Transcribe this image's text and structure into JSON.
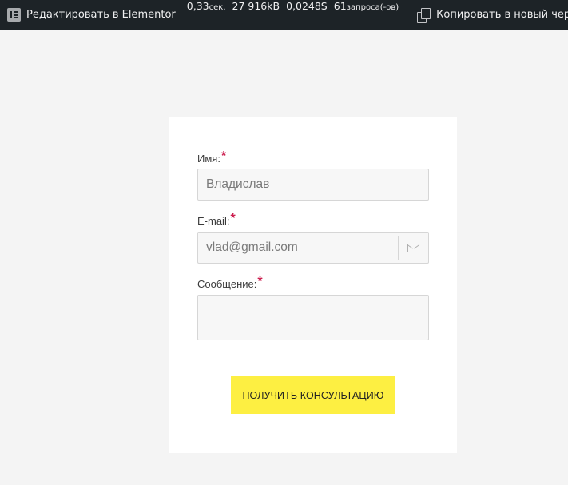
{
  "adminbar": {
    "elementor_label": "Редактировать в Elementor",
    "query_monitor": {
      "time_value": "0,33",
      "time_unit": "сек.",
      "memory": "27 916kB",
      "db_time": "0,0248S",
      "queries_count": "61",
      "queries_unit": "запроса(-ов)"
    },
    "copy_draft_label": "Копировать в новый черновик"
  },
  "form": {
    "name": {
      "label": "Имя:",
      "required_mark": "*",
      "value": "Владислав"
    },
    "email": {
      "label": "E-mail:",
      "required_mark": "*",
      "value": "vlad@gmail.com"
    },
    "message": {
      "label": "Сообщение:",
      "required_mark": "*",
      "value": ""
    },
    "submit_label": "ПОЛУЧИТЬ КОНСУЛЬТАЦИЮ"
  },
  "colors": {
    "adminbar_bg": "#1d2327",
    "page_bg": "#f4f4f4",
    "required": "#cc1f4f",
    "button_bg": "#fdef42"
  },
  "icons": {
    "elementor": "elementor-icon",
    "copy": "copy-icon",
    "email": "envelope-icon"
  }
}
